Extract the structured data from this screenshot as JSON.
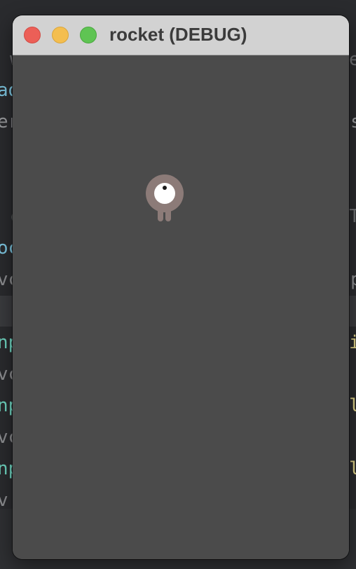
{
  "window": {
    "title": "rocket (DEBUG)"
  },
  "editor": {
    "lines": [
      {
        "left": "w",
        "right": "e"
      },
      {
        "left": "ad",
        "right": ""
      },
      {
        "left": "er",
        "right": "s"
      },
      {
        "left": "c",
        "right": "T"
      },
      {
        "left": "oc",
        "right": ""
      },
      {
        "left": "vc",
        "right": "p"
      },
      {
        "left": "np",
        "right": "i"
      },
      {
        "left": "vc",
        "right": ""
      },
      {
        "left": "np",
        "right": "le"
      },
      {
        "left": "vc",
        "right": ""
      },
      {
        "left": "np",
        "right": "le"
      },
      {
        "left": "v",
        "right": ""
      }
    ]
  },
  "sprite": {
    "name": "one-eyed-creature",
    "body_color": "#8c7b78",
    "eye_color": "#ffffff",
    "pupil_color": "#1a1a1a"
  },
  "colors": {
    "canvas_bg": "#4b4b4b",
    "titlebar_bg": "#d2d2d2",
    "close": "#ec5f57",
    "minimize": "#f4be4f",
    "maximize": "#5fc453"
  }
}
